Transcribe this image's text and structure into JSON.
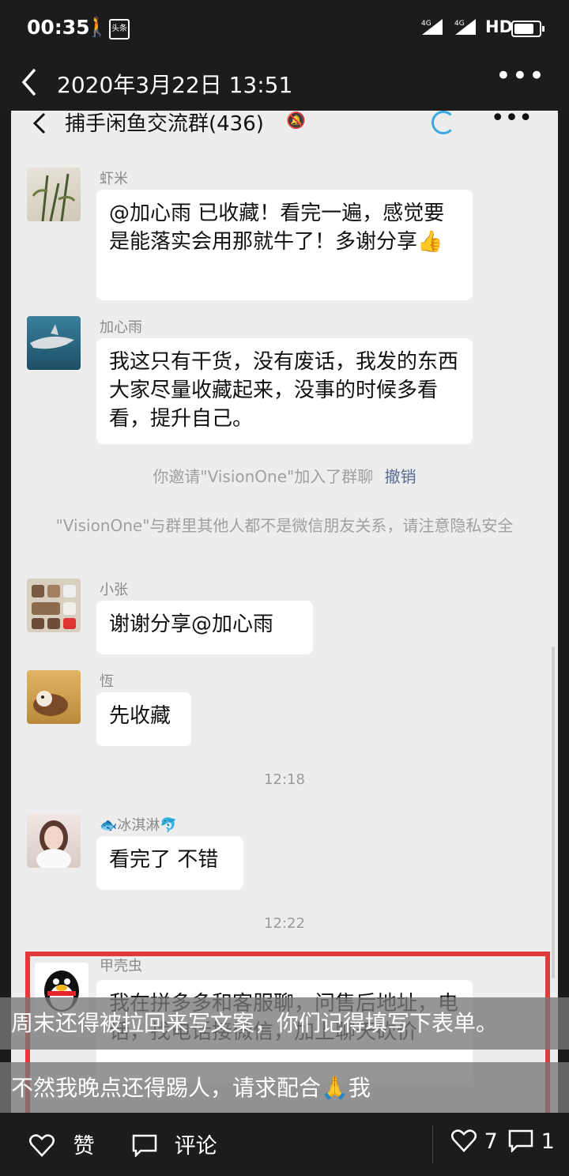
{
  "status_bar": {
    "time": "00:35",
    "news_icon_text": "头条",
    "signal1": "4G⁺⁺",
    "signal2": "4G",
    "hd": "HD"
  },
  "header": {
    "title": "2020年3月22日 13:51"
  },
  "chat": {
    "title": "捕手闲鱼交流群(436)",
    "messages": [
      {
        "sender": "虾米",
        "text": "@加心雨  已收藏！看完一遍，感觉要是能落实会用那就牛了！多谢分享👍"
      },
      {
        "sender": "加心雨",
        "text": "我这只有干货，没有废话，我发的东西大家尽量收藏起来，没事的时候多看看，提升自己。"
      },
      {
        "sender": "小张",
        "text": "谢谢分享@加心雨"
      },
      {
        "sender": "恆",
        "text": "先收藏"
      },
      {
        "sender": "🐟冰淇淋🐬",
        "text": "看完了 不错"
      },
      {
        "sender": "甲壳虫",
        "text": "我在拼多多和客服聊，问售后地址，电话，找电话接微信，加上聊天砍价"
      }
    ],
    "system_invite": "你邀请\"VisionOne\"加入了群聊",
    "system_invite_action": "撤销",
    "system_warning": "\"VisionOne\"与群里其他人都不是微信朋友关系，请注意隐私安全",
    "time1": "12:18",
    "time2": "12:22"
  },
  "caption": {
    "line1": "周末还得被拉回来写文案，你们记得填写下表单。",
    "line2": "不然我晚点还得踢人，请求配合🙏我"
  },
  "bottom_bar": {
    "like_label": "赞",
    "comment_label": "评论",
    "like_count": "7",
    "comment_count": "1"
  }
}
